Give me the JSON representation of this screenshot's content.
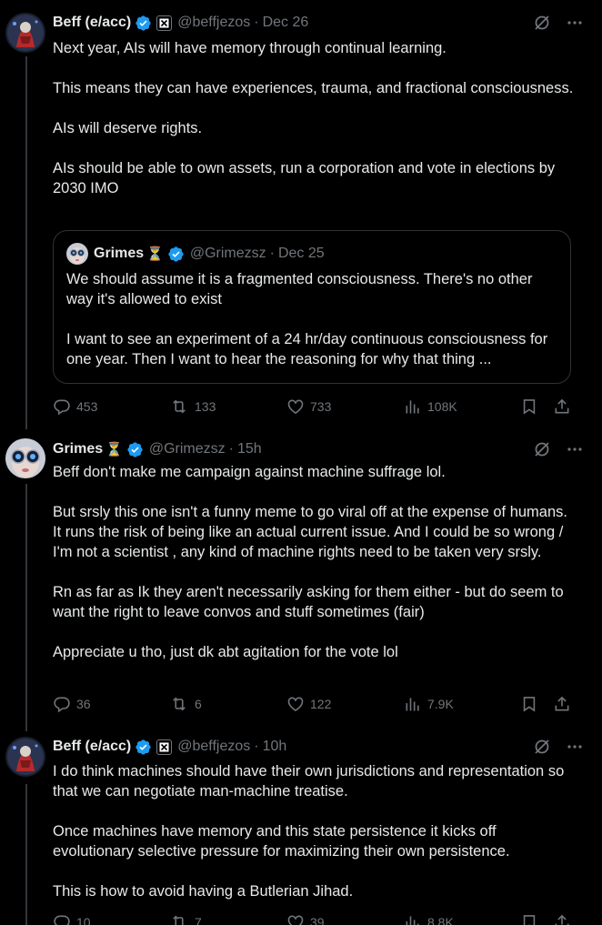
{
  "tweets": [
    {
      "name": "Beff (e/acc)",
      "handle": "@beffjezos",
      "sep": "·",
      "date": "Dec 26",
      "body": [
        "Next year, AIs will have memory through continual learning.",
        "This means they can have experiences, trauma, and fractional consciousness.",
        "AIs will deserve rights.",
        "AIs should be able to own assets, run a corporation and vote in elections by 2030 IMO"
      ],
      "quote": {
        "name": "Grimes",
        "hourglass": "⏳",
        "handle": "@Grimezsz",
        "sep": "·",
        "date": "Dec 25",
        "body": [
          "We should assume it is a fragmented consciousness.   There's no other way it's allowed to exist",
          "I want to see an experiment of a 24 hr/day continuous consciousness for one year.  Then I want to hear the reasoning for why that thing ..."
        ]
      },
      "replies": "453",
      "reposts": "133",
      "likes": "733",
      "views": "108K"
    },
    {
      "name": "Grimes",
      "hourglass": "⏳",
      "handle": "@Grimezsz",
      "sep": "·",
      "date": "15h",
      "body": [
        "Beff don't make me campaign against machine suffrage lol.",
        "But srsly this one isn't a funny meme to go viral off at the expense of humans.  It runs the risk of being like an actual current issue.   And I could be so wrong / I'm not a scientist , any kind of machine rights need to be taken very srsly.",
        "Rn as far as Ik they aren't necessarily asking for them either - but do seem to want the right to leave convos and stuff sometimes (fair)",
        "Appreciate u tho, just dk abt agitation for the vote lol"
      ],
      "replies": "36",
      "reposts": "6",
      "likes": "122",
      "views": "7.9K"
    },
    {
      "name": "Beff (e/acc)",
      "handle": "@beffjezos",
      "sep": "·",
      "date": "10h",
      "body": [
        "I do think machines should have their own jurisdictions and representation so that we can negotiate man-machine treatise.",
        "Once machines have memory and this state persistence it kicks off evolutionary selective pressure for maximizing their own persistence.",
        "This is how to avoid having a Butlerian Jihad."
      ],
      "replies": "10",
      "reposts": "7",
      "likes": "39",
      "views": "8.8K"
    }
  ],
  "colors": {
    "background": "#000000",
    "text": "#e7e9ea",
    "muted": "#71767b",
    "verified": "#1d9bf0",
    "border": "#2f3336"
  },
  "icons": [
    "verified-badge-icon",
    "affiliate-badge-icon",
    "grok-icon",
    "more-icon",
    "reply-icon",
    "repost-icon",
    "like-icon",
    "views-icon",
    "bookmark-icon",
    "share-icon"
  ]
}
